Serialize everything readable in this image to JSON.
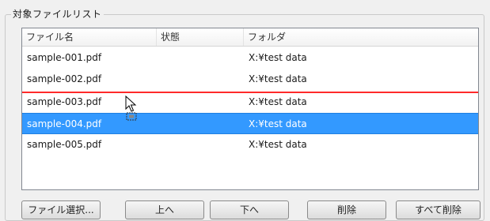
{
  "group": {
    "title": "対象ファイルリスト"
  },
  "list": {
    "columns": [
      "ファイル名",
      "状態",
      "フォルダ"
    ],
    "rows": [
      {
        "file": "sample-001.pdf",
        "status": "",
        "folder": "X:¥test data"
      },
      {
        "file": "sample-002.pdf",
        "status": "",
        "folder": "X:¥test data"
      },
      {
        "file": "sample-003.pdf",
        "status": "",
        "folder": "X:¥test data"
      },
      {
        "file": "sample-004.pdf",
        "status": "",
        "folder": "X:¥test data",
        "selected": true
      },
      {
        "file": "sample-005.pdf",
        "status": "",
        "folder": "X:¥test data"
      }
    ],
    "drop_indicator_color": "#ff2a2a",
    "selection_color": "#3399ff"
  },
  "cursor": {
    "icon": "drag-copy-cursor-icon"
  },
  "buttons": {
    "select_files": "ファイル選択...",
    "move_up": "上へ",
    "move_down": "下へ",
    "delete": "削除",
    "delete_all": "すべて削除"
  }
}
